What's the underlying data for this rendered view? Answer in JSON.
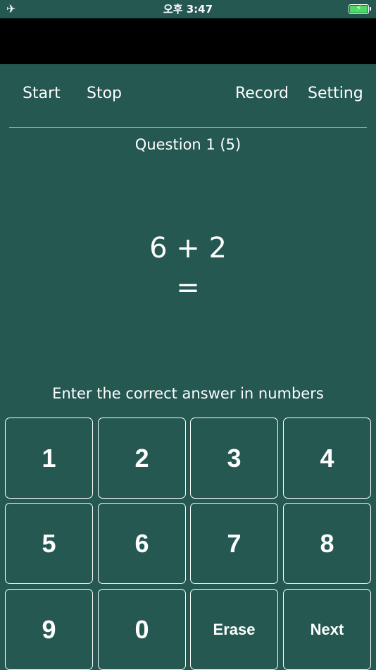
{
  "status": {
    "time": "오후 3:47",
    "airplane_icon": "✈",
    "battery_icon": "⚡"
  },
  "nav": {
    "start": "Start",
    "stop": "Stop",
    "record": "Record",
    "setting": "Setting"
  },
  "question": {
    "label": "Question 1 (5)",
    "expression": "6 + 2",
    "equals": "="
  },
  "instruction": "Enter the correct answer in numbers",
  "keypad": {
    "k1": "1",
    "k2": "2",
    "k3": "3",
    "k4": "4",
    "k5": "5",
    "k6": "6",
    "k7": "7",
    "k8": "8",
    "k9": "9",
    "k0": "0",
    "erase": "Erase",
    "next": "Next"
  },
  "colors": {
    "background": "#245851",
    "text": "#ffffff",
    "battery": "#4cd964"
  }
}
